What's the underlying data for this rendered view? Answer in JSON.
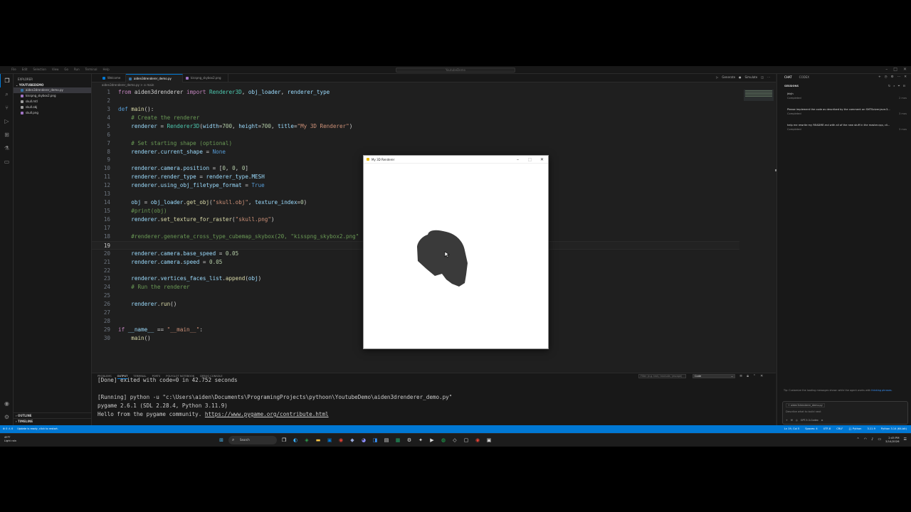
{
  "menu": [
    "File",
    "Edit",
    "Selection",
    "View",
    "Go",
    "Run",
    "Terminal",
    "Help"
  ],
  "command_center": "YoutubeDemo",
  "explorer": {
    "title": "EXPLORER",
    "root": "YOUTUBEDEMO",
    "files": [
      {
        "name": "aiden3drenderer_demo.py",
        "color": "#3572a5",
        "selected": true
      },
      {
        "name": "kisspng_skybox2.png",
        "color": "#a074c4"
      },
      {
        "name": "skull.mtl",
        "color": "#9e9e9e"
      },
      {
        "name": "skull.obj",
        "color": "#9e9e9e"
      },
      {
        "name": "skull.png",
        "color": "#a074c4"
      }
    ],
    "outline": "OUTLINE",
    "timeline": "TIMELINE"
  },
  "tabs": [
    {
      "label": "Welcome",
      "color": "#0078d4"
    },
    {
      "label": "aiden3drenderer_demo.py",
      "color": "#3572a5",
      "active": true
    },
    {
      "label": "kisspng_skybox2.png",
      "color": "#a074c4"
    }
  ],
  "run_actions": {
    "generate": "Generate",
    "simulate": "Simulate"
  },
  "breadcrumb": "aiden3drenderer_demo.py > ⊙ main",
  "code_lines": [
    [
      [
        "kw",
        "from "
      ],
      [
        "tx",
        "aiden3drenderer "
      ],
      [
        "kw",
        "import "
      ],
      [
        "cl",
        "Renderer3D"
      ],
      [
        "tx",
        ", "
      ],
      [
        "vr",
        "obj_loader"
      ],
      [
        "tx",
        ", "
      ],
      [
        "vr",
        "renderer_type"
      ]
    ],
    [],
    [
      [
        "bl",
        "def "
      ],
      [
        "fn",
        "main"
      ],
      [
        "tx",
        "():"
      ]
    ],
    [
      [
        "tx",
        "    "
      ],
      [
        "cm",
        "# Create the renderer"
      ]
    ],
    [
      [
        "tx",
        "    "
      ],
      [
        "vr",
        "renderer"
      ],
      [
        "tx",
        " = "
      ],
      [
        "cl",
        "Renderer3D"
      ],
      [
        "tx",
        "("
      ],
      [
        "vr",
        "width"
      ],
      [
        "tx",
        "="
      ],
      [
        "nm",
        "700"
      ],
      [
        "tx",
        ", "
      ],
      [
        "vr",
        "height"
      ],
      [
        "tx",
        "="
      ],
      [
        "nm",
        "700"
      ],
      [
        "tx",
        ", "
      ],
      [
        "vr",
        "title"
      ],
      [
        "tx",
        "="
      ],
      [
        "st",
        "\"My 3D Renderer\""
      ],
      [
        "tx",
        ")"
      ]
    ],
    [],
    [
      [
        "tx",
        "    "
      ],
      [
        "cm",
        "# Set starting shape (optional)"
      ]
    ],
    [
      [
        "tx",
        "    "
      ],
      [
        "vr",
        "renderer"
      ],
      [
        "tx",
        "."
      ],
      [
        "vr",
        "current_shape"
      ],
      [
        "tx",
        " = "
      ],
      [
        "bl",
        "None"
      ]
    ],
    [],
    [
      [
        "tx",
        "    "
      ],
      [
        "vr",
        "renderer"
      ],
      [
        "tx",
        "."
      ],
      [
        "vr",
        "camera"
      ],
      [
        "tx",
        "."
      ],
      [
        "vr",
        "position"
      ],
      [
        "tx",
        " = ["
      ],
      [
        "nm",
        "0"
      ],
      [
        "tx",
        ", "
      ],
      [
        "nm",
        "0"
      ],
      [
        "tx",
        ", "
      ],
      [
        "nm",
        "0"
      ],
      [
        "tx",
        "]"
      ]
    ],
    [
      [
        "tx",
        "    "
      ],
      [
        "vr",
        "renderer"
      ],
      [
        "tx",
        "."
      ],
      [
        "vr",
        "render_type"
      ],
      [
        "tx",
        " = "
      ],
      [
        "vr",
        "renderer_type"
      ],
      [
        "tx",
        "."
      ],
      [
        "vr",
        "MESH"
      ]
    ],
    [
      [
        "tx",
        "    "
      ],
      [
        "vr",
        "renderer"
      ],
      [
        "tx",
        "."
      ],
      [
        "vr",
        "using_obj_filetype_format"
      ],
      [
        "tx",
        " = "
      ],
      [
        "bl",
        "True"
      ]
    ],
    [],
    [
      [
        "tx",
        "    "
      ],
      [
        "vr",
        "obj"
      ],
      [
        "tx",
        " = "
      ],
      [
        "vr",
        "obj_loader"
      ],
      [
        "tx",
        "."
      ],
      [
        "fn",
        "get_obj"
      ],
      [
        "tx",
        "("
      ],
      [
        "st",
        "\"skull.obj\""
      ],
      [
        "tx",
        ", "
      ],
      [
        "vr",
        "texture_index"
      ],
      [
        "tx",
        "="
      ],
      [
        "nm",
        "0"
      ],
      [
        "tx",
        ")"
      ]
    ],
    [
      [
        "tx",
        "    "
      ],
      [
        "cm",
        "#print(obj)"
      ]
    ],
    [
      [
        "tx",
        "    "
      ],
      [
        "vr",
        "renderer"
      ],
      [
        "tx",
        "."
      ],
      [
        "fn",
        "set_texture_for_raster"
      ],
      [
        "tx",
        "("
      ],
      [
        "st",
        "\"skull.png\""
      ],
      [
        "tx",
        ")"
      ]
    ],
    [],
    [
      [
        "tx",
        "    "
      ],
      [
        "cm",
        "#renderer.generate_cross_type_cubemap_skybox(20, \"kisspng_skybox2.png\""
      ]
    ],
    [],
    [
      [
        "tx",
        "    "
      ],
      [
        "vr",
        "renderer"
      ],
      [
        "tx",
        "."
      ],
      [
        "vr",
        "camera"
      ],
      [
        "tx",
        "."
      ],
      [
        "vr",
        "base_speed"
      ],
      [
        "tx",
        " = "
      ],
      [
        "nm",
        "0.05"
      ]
    ],
    [
      [
        "tx",
        "    "
      ],
      [
        "vr",
        "renderer"
      ],
      [
        "tx",
        "."
      ],
      [
        "vr",
        "camera"
      ],
      [
        "tx",
        "."
      ],
      [
        "vr",
        "speed"
      ],
      [
        "tx",
        " = "
      ],
      [
        "nm",
        "0.05"
      ]
    ],
    [],
    [
      [
        "tx",
        "    "
      ],
      [
        "vr",
        "renderer"
      ],
      [
        "tx",
        "."
      ],
      [
        "vr",
        "vertices_faces_list"
      ],
      [
        "tx",
        "."
      ],
      [
        "fn",
        "append"
      ],
      [
        "tx",
        "("
      ],
      [
        "vr",
        "obj"
      ],
      [
        "tx",
        ")"
      ]
    ],
    [
      [
        "tx",
        "    "
      ],
      [
        "cm",
        "# Run the renderer"
      ]
    ],
    [],
    [
      [
        "tx",
        "    "
      ],
      [
        "vr",
        "renderer"
      ],
      [
        "tx",
        "."
      ],
      [
        "fn",
        "run"
      ],
      [
        "tx",
        "()"
      ]
    ],
    [],
    [],
    [
      [
        "kw",
        "if "
      ],
      [
        "vr",
        "__name__"
      ],
      [
        "tx",
        " == "
      ],
      [
        "st",
        "\"__main__\""
      ],
      [
        "tx",
        ":"
      ]
    ],
    [
      [
        "tx",
        "    "
      ],
      [
        "fn",
        "main"
      ],
      [
        "tx",
        "()"
      ]
    ]
  ],
  "current_line": 19,
  "panel": {
    "tabs": [
      "PROBLEMS",
      "OUTPUT",
      "TERMINAL",
      "PORTS",
      "POLYGLOT NOTEBOOK",
      "DEBUG CONSOLE"
    ],
    "active_tab": "OUTPUT",
    "filter_placeholder": "Filter (e.g. text, !exclude, \\escape)",
    "channel": "Code",
    "lines": [
      "[Done] exited with code=0 in 42.752 seconds",
      "",
      "[Running] python -u \"c:\\Users\\aiden\\Documents\\ProgramingProjects\\pythoon\\YoutubeDemo\\aiden3drenderer_demo.py\"",
      "pygame 2.6.1 (SDL 2.28.4, Python 3.11.9)"
    ],
    "hello_prefix": "Hello from the pygame community. ",
    "hello_link": "https://www.pygame.org/contribute.html"
  },
  "chat": {
    "tabs": [
      "CHAT",
      "CODEX"
    ],
    "sessions_title": "SESSIONS",
    "sessions": [
      {
        "title": "jhkjh",
        "status": "Completed",
        "time": "2 mos"
      },
      {
        "title": "Please implement the code as described by the comment on SMTSolver.java:3...",
        "status": "Completed",
        "time": "3 mos"
      },
      {
        "title": "help me rewrite my README.md with all of the new stuff in the master.cpp, cli...",
        "status": "Completed",
        "time": "3 mos"
      }
    ],
    "tip_text": "Tip: Customize the loading messages shown while the agent works with ",
    "tip_link": "thinking phrases.",
    "attachment": "aiden3drenderer_demo.py",
    "input_placeholder": "Describe what to build next",
    "model": "GPT-5.3-Codex"
  },
  "status_bar": {
    "left": [
      "⊗ 0 ⚠ 0",
      "Update is ready, click to restart."
    ],
    "right": [
      "Ln 19, Col 5",
      "Spaces: 4",
      "UTF-8",
      "CRLF",
      "{} Python",
      "3.11.9",
      "Python 3.14 (64-bit)"
    ]
  },
  "renderer_window": {
    "title": "My 3D Renderer",
    "bg": "#ffffff",
    "skull_color": "#3a3a3a"
  },
  "taskbar": {
    "weather_temp": "49°F",
    "weather_desc": "Light rain",
    "search": "Search",
    "time": "2:45 PM",
    "date": "3/14/2026"
  }
}
